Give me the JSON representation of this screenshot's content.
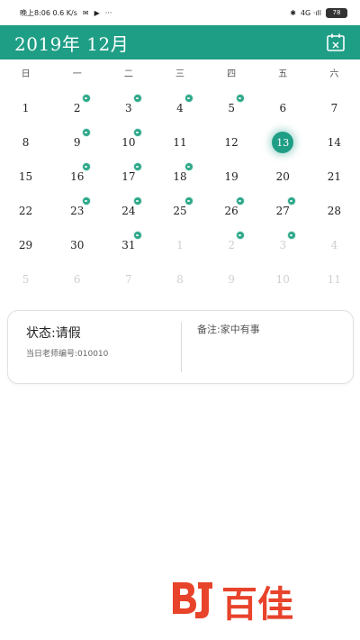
{
  "statusbar": {
    "left_text": "晚上8:06 0.6 K/s",
    "right_text": "4G ·ıll",
    "battery": "78"
  },
  "header": {
    "title": "2019年 12月"
  },
  "weekdays": [
    "日",
    "一",
    "二",
    "三",
    "四",
    "五",
    "六"
  ],
  "calendar": {
    "days": [
      {
        "n": "1",
        "dot": false,
        "muted": false
      },
      {
        "n": "2",
        "dot": true,
        "muted": false
      },
      {
        "n": "3",
        "dot": true,
        "muted": false
      },
      {
        "n": "4",
        "dot": true,
        "muted": false
      },
      {
        "n": "5",
        "dot": true,
        "muted": false
      },
      {
        "n": "6",
        "dot": false,
        "muted": false
      },
      {
        "n": "7",
        "dot": false,
        "muted": false
      },
      {
        "n": "8",
        "dot": false,
        "muted": false
      },
      {
        "n": "9",
        "dot": true,
        "muted": false
      },
      {
        "n": "10",
        "dot": true,
        "muted": false
      },
      {
        "n": "11",
        "dot": false,
        "muted": false
      },
      {
        "n": "12",
        "dot": false,
        "muted": false
      },
      {
        "n": "13",
        "dot": false,
        "muted": false,
        "selected": true
      },
      {
        "n": "14",
        "dot": false,
        "muted": false
      },
      {
        "n": "15",
        "dot": false,
        "muted": false
      },
      {
        "n": "16",
        "dot": true,
        "muted": false
      },
      {
        "n": "17",
        "dot": true,
        "muted": false
      },
      {
        "n": "18",
        "dot": true,
        "muted": false
      },
      {
        "n": "19",
        "dot": false,
        "muted": false
      },
      {
        "n": "20",
        "dot": false,
        "muted": false
      },
      {
        "n": "21",
        "dot": false,
        "muted": false
      },
      {
        "n": "22",
        "dot": false,
        "muted": false
      },
      {
        "n": "23",
        "dot": true,
        "muted": false
      },
      {
        "n": "24",
        "dot": true,
        "muted": false
      },
      {
        "n": "25",
        "dot": true,
        "muted": false
      },
      {
        "n": "26",
        "dot": true,
        "muted": false
      },
      {
        "n": "27",
        "dot": true,
        "muted": false
      },
      {
        "n": "28",
        "dot": false,
        "muted": false
      },
      {
        "n": "29",
        "dot": false,
        "muted": false
      },
      {
        "n": "30",
        "dot": false,
        "muted": false
      },
      {
        "n": "31",
        "dot": true,
        "muted": false
      },
      {
        "n": "1",
        "dot": false,
        "muted": true
      },
      {
        "n": "2",
        "dot": true,
        "muted": true
      },
      {
        "n": "3",
        "dot": true,
        "muted": true
      },
      {
        "n": "4",
        "dot": false,
        "muted": true
      },
      {
        "n": "5",
        "dot": false,
        "muted": true
      },
      {
        "n": "6",
        "dot": false,
        "muted": true
      },
      {
        "n": "7",
        "dot": false,
        "muted": true
      },
      {
        "n": "8",
        "dot": false,
        "muted": true
      },
      {
        "n": "9",
        "dot": false,
        "muted": true
      },
      {
        "n": "10",
        "dot": false,
        "muted": true
      },
      {
        "n": "11",
        "dot": false,
        "muted": true
      }
    ]
  },
  "detail": {
    "status": "状态:请假",
    "teacher": "当日老师编号:010010",
    "remark": "备注:家中有事"
  },
  "brand": {
    "text": "百佳",
    "color": "#e8432b"
  }
}
